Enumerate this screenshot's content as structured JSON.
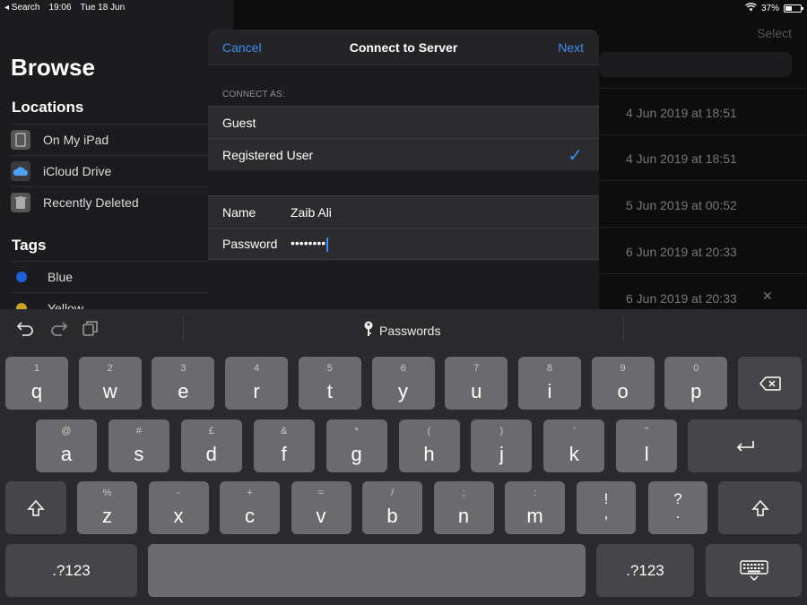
{
  "status": {
    "back_app": "◂ Search",
    "time": "19:06",
    "date": "Tue 18 Jun",
    "battery": "37%"
  },
  "sidebar": {
    "title": "Browse",
    "locations_header": "Locations",
    "locations": [
      "On My iPad",
      "iCloud Drive",
      "Recently Deleted"
    ],
    "tags_header": "Tags",
    "tags": [
      {
        "label": "Blue",
        "color": "#1e5fd8"
      },
      {
        "label": "Yellow",
        "color": "#c9a227"
      }
    ]
  },
  "main": {
    "select_label": "Select",
    "dates": [
      "4 Jun 2019 at 18:51",
      "4 Jun 2019 at 18:51",
      "5 Jun 2019 at 00:52",
      "6 Jun 2019 at 20:33",
      "6 Jun 2019 at 20:33"
    ]
  },
  "modal": {
    "cancel": "Cancel",
    "title": "Connect to Server",
    "next": "Next",
    "connect_as": "CONNECT AS:",
    "guest": "Guest",
    "registered": "Registered User",
    "checkmark": "✓",
    "name_label": "Name",
    "name_value": "Zaib Ali",
    "password_label": "Password",
    "password_value": "••••••••"
  },
  "keyboard": {
    "passwords_label": "Passwords",
    "row1": [
      {
        "s": "1",
        "m": "q"
      },
      {
        "s": "2",
        "m": "w"
      },
      {
        "s": "3",
        "m": "e"
      },
      {
        "s": "4",
        "m": "r"
      },
      {
        "s": "5",
        "m": "t"
      },
      {
        "s": "6",
        "m": "y"
      },
      {
        "s": "7",
        "m": "u"
      },
      {
        "s": "8",
        "m": "i"
      },
      {
        "s": "9",
        "m": "o"
      },
      {
        "s": "0",
        "m": "p"
      }
    ],
    "row2": [
      {
        "s": "@",
        "m": "a"
      },
      {
        "s": "#",
        "m": "s"
      },
      {
        "s": "£",
        "m": "d"
      },
      {
        "s": "&",
        "m": "f"
      },
      {
        "s": "*",
        "m": "g"
      },
      {
        "s": "(",
        "m": "h"
      },
      {
        "s": ")",
        "m": "j"
      },
      {
        "s": "'",
        "m": "k"
      },
      {
        "s": "\"",
        "m": "l"
      }
    ],
    "row3": [
      {
        "s": "%",
        "m": "z"
      },
      {
        "s": "-",
        "m": "x"
      },
      {
        "s": "+",
        "m": "c"
      },
      {
        "s": "=",
        "m": "v"
      },
      {
        "s": "/",
        "m": "b"
      },
      {
        "s": ";",
        "m": "n"
      },
      {
        "s": ":",
        "m": "m"
      }
    ],
    "punct1": {
      "top": "!",
      "bottom": ","
    },
    "punct2": {
      "top": "?",
      "bottom": "."
    },
    "numbers_label": ".?123",
    "backspace": "⌫",
    "return": "↵",
    "shift": "⇧",
    "hide_keyboard": "⌨"
  }
}
